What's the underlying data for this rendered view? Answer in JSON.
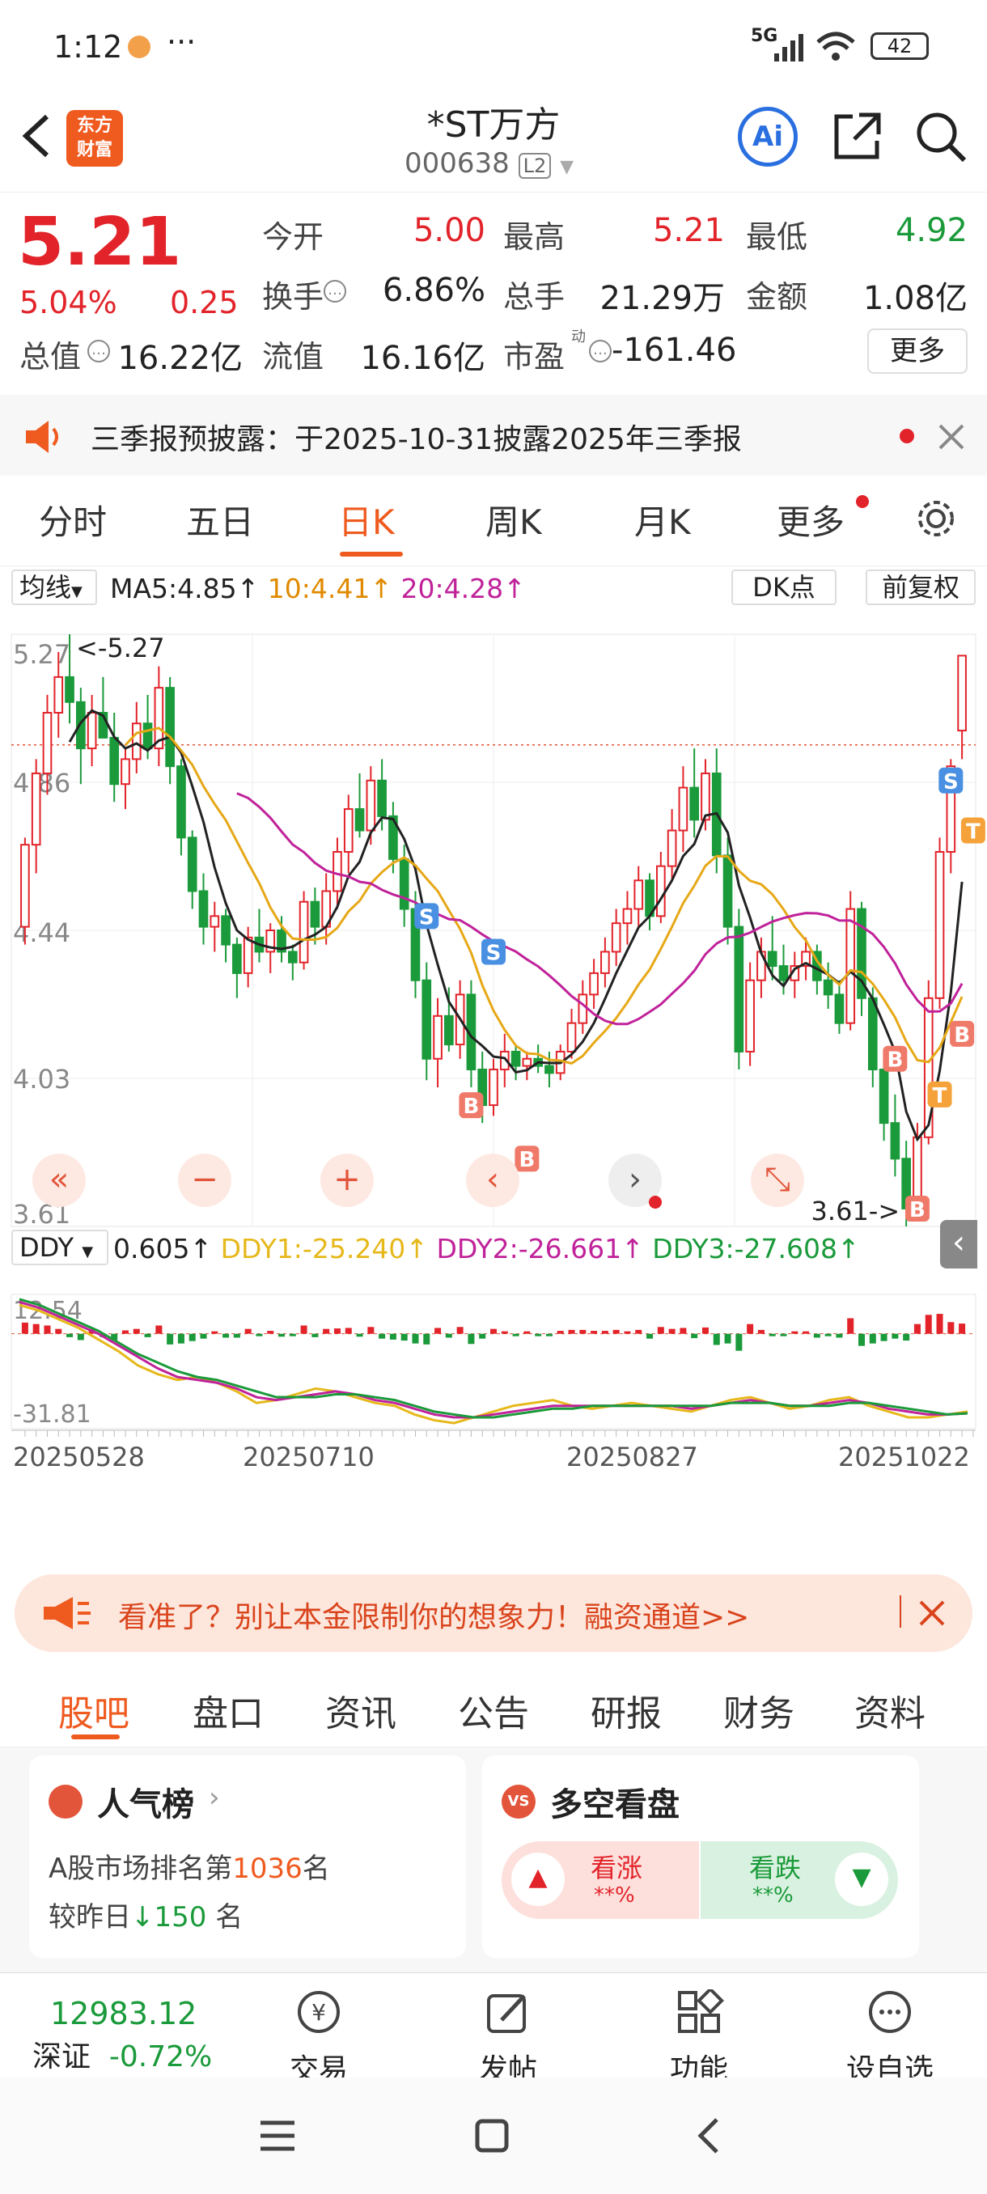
{
  "status_bar": {
    "time": "1:12",
    "dots": "···",
    "network": "5G",
    "battery": "42"
  },
  "header": {
    "title": "*ST万方",
    "code": "000638",
    "level": "L2",
    "logo_text_1": "东方",
    "logo_text_2": "财富",
    "ai_label": "Ai"
  },
  "quote": {
    "price": "5.21",
    "change_pct": "5.04%",
    "change": "0.25",
    "open_label": "今开",
    "open": "5.00",
    "high_label": "最高",
    "high": "5.21",
    "low_label": "最低",
    "low": "4.92",
    "turnover_label": "换手",
    "turnover": "6.86%",
    "volume_label": "总手",
    "volume": "21.29万",
    "amount_label": "金额",
    "amount": "1.08亿",
    "mktcap_label": "总值",
    "mktcap": "16.22亿",
    "float_label": "流值",
    "float": "16.16亿",
    "pe_label": "市盈",
    "pe_sup": "动",
    "pe": "-161.46",
    "more_button": "更多"
  },
  "notice": {
    "text": "三季报预披露：于2025-10-31披露2025年三季报"
  },
  "kline_tabs": {
    "tabs": [
      "分时",
      "五日",
      "日K",
      "周K",
      "月K",
      "更多"
    ],
    "active_index": 2
  },
  "chart_toolbar": {
    "ma_select": "均线",
    "ma5": "MA5:4.85",
    "ma10": "10:4.41",
    "ma20": "20:4.28",
    "dk_button": "DK点",
    "adjust_button": "前复权",
    "arrow": "↑"
  },
  "chart_data": [
    {
      "type": "candlestick",
      "title": "",
      "ylim": [
        3.61,
        5.27
      ],
      "y_ticks": [
        "5.27",
        "4.86",
        "4.44",
        "4.03",
        "3.61"
      ],
      "annotations": {
        "high": "<-5.27",
        "low": "3.61->"
      },
      "ma_colors": {
        "ma5": "#222222",
        "ma10": "#e6a817",
        "ma20": "#c0229a"
      },
      "candles": [
        [
          4.45,
          4.7,
          4.4,
          4.68
        ],
        [
          4.68,
          4.92,
          4.6,
          4.88
        ],
        [
          4.88,
          5.1,
          4.82,
          5.05
        ],
        [
          5.05,
          5.22,
          4.98,
          5.15
        ],
        [
          5.15,
          5.27,
          5.02,
          5.08
        ],
        [
          5.08,
          5.12,
          4.85,
          4.95
        ],
        [
          4.95,
          5.1,
          4.9,
          5.05
        ],
        [
          5.05,
          5.15,
          4.98,
          4.98
        ],
        [
          4.98,
          5.05,
          4.8,
          4.85
        ],
        [
          4.85,
          4.95,
          4.78,
          4.92
        ],
        [
          4.92,
          5.08,
          4.88,
          5.02
        ],
        [
          5.02,
          5.1,
          4.92,
          4.95
        ],
        [
          4.95,
          5.18,
          4.9,
          5.12
        ],
        [
          5.12,
          5.15,
          4.85,
          4.9
        ],
        [
          4.9,
          4.92,
          4.65,
          4.7
        ],
        [
          4.7,
          4.72,
          4.5,
          4.55
        ],
        [
          4.55,
          4.6,
          4.4,
          4.45
        ],
        [
          4.45,
          4.52,
          4.38,
          4.48
        ],
        [
          4.48,
          4.5,
          4.35,
          4.4
        ],
        [
          4.4,
          4.42,
          4.25,
          4.32
        ],
        [
          4.32,
          4.45,
          4.28,
          4.42
        ],
        [
          4.42,
          4.5,
          4.35,
          4.38
        ],
        [
          4.38,
          4.46,
          4.32,
          4.44
        ],
        [
          4.44,
          4.48,
          4.35,
          4.38
        ],
        [
          4.38,
          4.4,
          4.3,
          4.35
        ],
        [
          4.35,
          4.55,
          4.33,
          4.52
        ],
        [
          4.52,
          4.56,
          4.4,
          4.45
        ],
        [
          4.45,
          4.6,
          4.4,
          4.55
        ],
        [
          4.55,
          4.7,
          4.5,
          4.66
        ],
        [
          4.66,
          4.82,
          4.6,
          4.78
        ],
        [
          4.78,
          4.88,
          4.7,
          4.72
        ],
        [
          4.72,
          4.9,
          4.68,
          4.86
        ],
        [
          4.86,
          4.92,
          4.72,
          4.76
        ],
        [
          4.76,
          4.8,
          4.6,
          4.64
        ],
        [
          4.64,
          4.68,
          4.45,
          4.5
        ],
        [
          4.5,
          4.55,
          4.25,
          4.3
        ],
        [
          4.3,
          4.35,
          4.02,
          4.08
        ],
        [
          4.08,
          4.25,
          4.0,
          4.2
        ],
        [
          4.2,
          4.28,
          4.1,
          4.12
        ],
        [
          4.12,
          4.3,
          4.08,
          4.26
        ],
        [
          4.26,
          4.3,
          4.0,
          4.05
        ],
        [
          4.05,
          4.1,
          3.9,
          3.95
        ],
        [
          3.95,
          4.08,
          3.92,
          4.05
        ],
        [
          4.05,
          4.15,
          4.0,
          4.1
        ],
        [
          4.1,
          4.12,
          4.02,
          4.06
        ],
        [
          4.06,
          4.1,
          4.02,
          4.08
        ],
        [
          4.08,
          4.12,
          4.04,
          4.06
        ],
        [
          4.06,
          4.1,
          4.0,
          4.04
        ],
        [
          4.04,
          4.12,
          4.02,
          4.1
        ],
        [
          4.1,
          4.22,
          4.08,
          4.18
        ],
        [
          4.18,
          4.3,
          4.15,
          4.26
        ],
        [
          4.26,
          4.36,
          4.22,
          4.32
        ],
        [
          4.32,
          4.42,
          4.28,
          4.38
        ],
        [
          4.38,
          4.5,
          4.34,
          4.46
        ],
        [
          4.46,
          4.55,
          4.4,
          4.5
        ],
        [
          4.5,
          4.62,
          4.45,
          4.58
        ],
        [
          4.58,
          4.6,
          4.44,
          4.48
        ],
        [
          4.48,
          4.66,
          4.46,
          4.62
        ],
        [
          4.62,
          4.78,
          4.58,
          4.72
        ],
        [
          4.72,
          4.9,
          4.66,
          4.84
        ],
        [
          4.84,
          4.95,
          4.7,
          4.75
        ],
        [
          4.75,
          4.92,
          4.72,
          4.88
        ],
        [
          4.88,
          4.95,
          4.6,
          4.65
        ],
        [
          4.65,
          4.7,
          4.4,
          4.45
        ],
        [
          4.45,
          4.5,
          4.05,
          4.1
        ],
        [
          4.1,
          4.35,
          4.06,
          4.3
        ],
        [
          4.3,
          4.42,
          4.25,
          4.38
        ],
        [
          4.38,
          4.48,
          4.3,
          4.34
        ],
        [
          4.34,
          4.4,
          4.26,
          4.3
        ],
        [
          4.3,
          4.38,
          4.25,
          4.34
        ],
        [
          4.34,
          4.42,
          4.3,
          4.38
        ],
        [
          4.38,
          4.4,
          4.26,
          4.3
        ],
        [
          4.3,
          4.35,
          4.22,
          4.26
        ],
        [
          4.26,
          4.3,
          4.15,
          4.18
        ],
        [
          4.18,
          4.55,
          4.16,
          4.5
        ],
        [
          4.5,
          4.52,
          4.2,
          4.25
        ],
        [
          4.25,
          4.28,
          4.0,
          4.05
        ],
        [
          4.05,
          4.1,
          3.85,
          3.9
        ],
        [
          3.9,
          3.98,
          3.75,
          3.8
        ],
        [
          3.8,
          3.85,
          3.61,
          3.66
        ],
        [
          3.66,
          3.9,
          3.63,
          3.86
        ],
        [
          3.86,
          4.3,
          3.84,
          4.25
        ],
        [
          4.25,
          4.7,
          4.22,
          4.66
        ],
        [
          4.66,
          4.92,
          4.6,
          4.9
        ],
        [
          5.0,
          5.21,
          4.92,
          5.21
        ]
      ],
      "signals": [
        {
          "label": "B",
          "index": 40,
          "price": 3.95
        },
        {
          "label": "B",
          "index": 45,
          "price": 3.8
        },
        {
          "label": "S",
          "index": 36,
          "price": 4.48
        },
        {
          "label": "S",
          "index": 42,
          "price": 4.38
        },
        {
          "label": "B",
          "index": 78,
          "price": 4.08
        },
        {
          "label": "B",
          "index": 80,
          "price": 3.66
        },
        {
          "label": "T",
          "index": 82,
          "price": 3.98
        },
        {
          "label": "B",
          "index": 84,
          "price": 4.15
        },
        {
          "label": "S",
          "index": 83,
          "price": 4.86
        },
        {
          "label": "T",
          "index": 85,
          "price": 4.72
        }
      ]
    },
    {
      "type": "line",
      "title": "",
      "ylim": [
        -31.81,
        12.54
      ],
      "y_ticks": [
        "12.54",
        "-31.81"
      ],
      "x_ticks": [
        "20250528",
        "20250710",
        "20250827",
        "20251022"
      ],
      "series": [
        {
          "name": "DDY1",
          "color": "#e6b81a",
          "values": [
            10,
            8,
            5,
            2,
            -2,
            -6,
            -11,
            -14,
            -16,
            -15,
            -17,
            -20,
            -24,
            -23,
            -21,
            -19,
            -20,
            -22,
            -24,
            -25,
            -28,
            -30,
            -31,
            -29,
            -27,
            -25,
            -24,
            -23,
            -25,
            -26,
            -25,
            -24,
            -25,
            -26,
            -27,
            -25,
            -23,
            -22,
            -24,
            -26,
            -25,
            -23,
            -22,
            -25,
            -27,
            -29,
            -29,
            -28,
            -27
          ]
        },
        {
          "name": "DDY2",
          "color": "#c0229a",
          "values": [
            11,
            9,
            6,
            3,
            0,
            -4,
            -8,
            -12,
            -15,
            -16,
            -17,
            -19,
            -22,
            -23,
            -22,
            -21,
            -20,
            -21,
            -23,
            -24,
            -26,
            -28,
            -29,
            -29,
            -28,
            -27,
            -26,
            -25,
            -25,
            -25,
            -25,
            -25,
            -25,
            -25,
            -26,
            -25,
            -24,
            -23,
            -24,
            -25,
            -25,
            -24,
            -23,
            -24,
            -26,
            -27,
            -28,
            -28,
            -27.6
          ]
        },
        {
          "name": "DDY3",
          "color": "#1a9a3a",
          "values": [
            12,
            10,
            7,
            4,
            1,
            -3,
            -7,
            -10,
            -13,
            -15,
            -16,
            -18,
            -20,
            -22,
            -22,
            -22,
            -21,
            -21,
            -22,
            -23,
            -25,
            -27,
            -28,
            -29,
            -29,
            -28,
            -27,
            -26,
            -26,
            -25,
            -25,
            -25,
            -25,
            -25,
            -25,
            -25,
            -24,
            -24,
            -24,
            -25,
            -25,
            -25,
            -24,
            -24,
            -25,
            -26,
            -27,
            -28,
            -27.6
          ]
        }
      ],
      "legend": {
        "ddy": "DDY",
        "value": "0.605",
        "ddy1": "DDY1:-25.240",
        "ddy2": "DDY2:-26.661",
        "ddy3": "DDY3:-27.608"
      }
    }
  ],
  "chart_controls": {
    "pan_left": "«",
    "zoom_out": "−",
    "zoom_in": "+",
    "prev": "‹",
    "next": "›",
    "fullscreen": "⤡"
  },
  "ad": {
    "text": "看准了？别让本金限制你的想象力！融资通道>>"
  },
  "guba_tabs": {
    "tabs": [
      "股吧",
      "盘口",
      "资讯",
      "公告",
      "研报",
      "财务",
      "资料"
    ],
    "active_index": 0
  },
  "popularity": {
    "title": "人气榜",
    "rank_prefix": "A股市场排名第",
    "rank": "1036",
    "rank_suffix": "名",
    "change_prefix": "较昨日",
    "change": "150",
    "change_suffix": " 名"
  },
  "sentiment": {
    "title": "多空看盘",
    "bull_label": "看涨",
    "bull_value": "**%",
    "bear_label": "看跌",
    "bear_value": "**%"
  },
  "bottom_bar": {
    "index_value": "12983.12",
    "index_name": "深证",
    "index_change": "-0.72%",
    "items": [
      "交易",
      "发帖",
      "功能",
      "设自选"
    ]
  }
}
